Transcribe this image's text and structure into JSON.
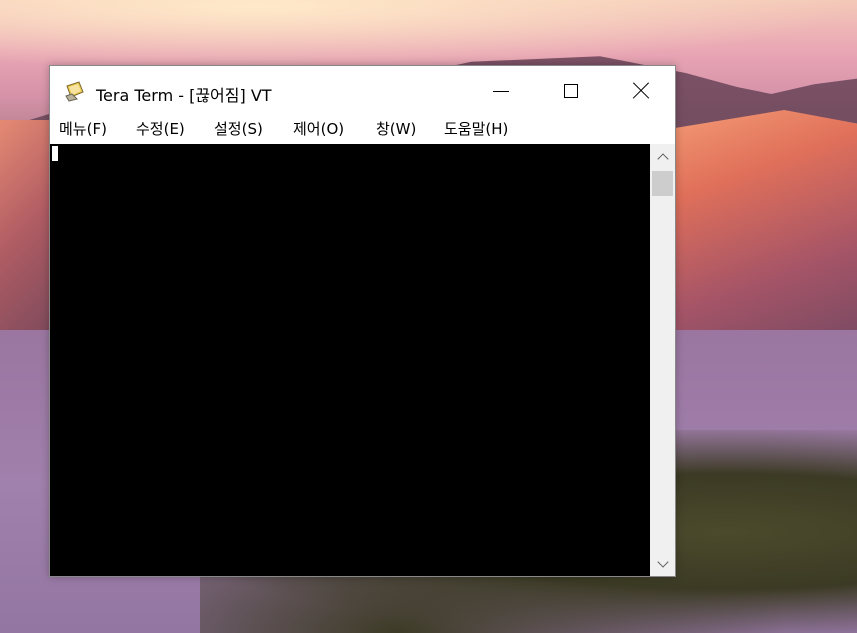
{
  "window": {
    "title": "Tera Term - [끊어짐] VT",
    "app_icon": "tera-term-icon"
  },
  "menu": {
    "items": [
      {
        "label": "메뉴(F)"
      },
      {
        "label": "수정(E)"
      },
      {
        "label": "설정(S)"
      },
      {
        "label": "제어(O)"
      },
      {
        "label": "창(W)"
      },
      {
        "label": "도움말(H)"
      }
    ]
  },
  "terminal": {
    "background": "#000000",
    "cursor_color": "#ffffff"
  },
  "icons": {
    "minimize": "minimize-icon",
    "maximize": "maximize-icon",
    "close": "close-icon",
    "scroll_up": "chevron-up-icon",
    "scroll_down": "chevron-down-icon"
  }
}
